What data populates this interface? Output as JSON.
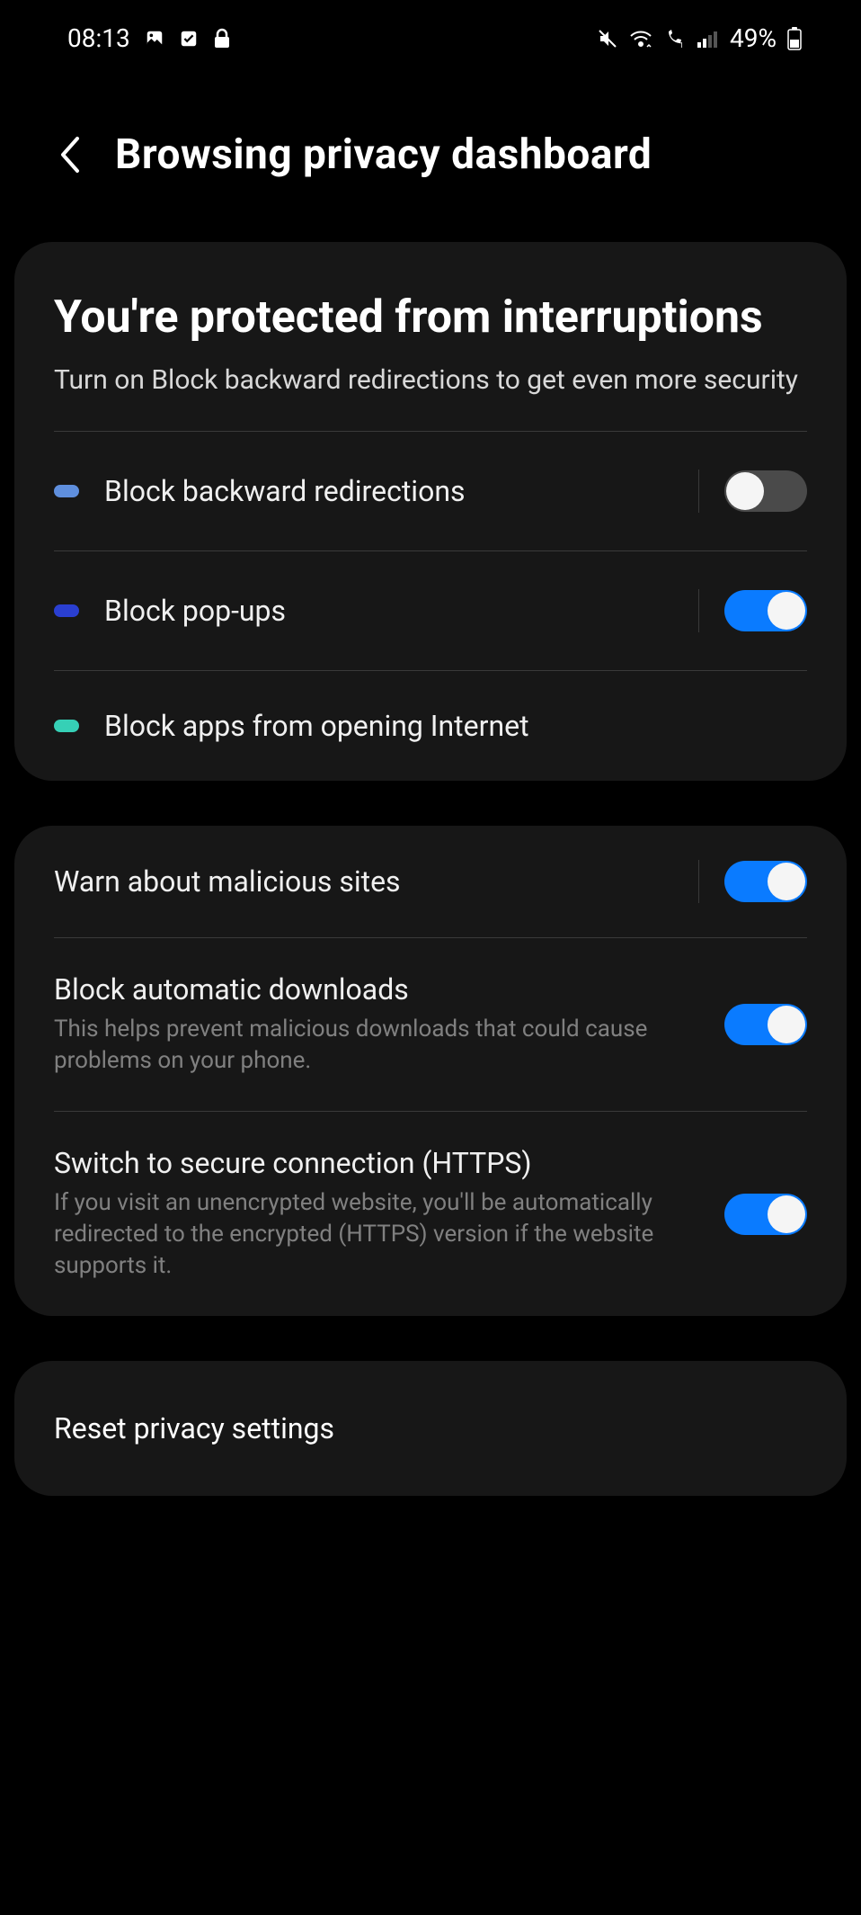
{
  "status": {
    "time": "08:13",
    "battery_pct": "49%"
  },
  "header": {
    "title": "Browsing privacy dashboard"
  },
  "hero": {
    "title": "You're protected from interruptions",
    "subtitle": "Turn on Block backward redirections to get even more security"
  },
  "section1": {
    "backward": {
      "label": "Block backward redirections",
      "on": false
    },
    "popups": {
      "label": "Block pop-ups",
      "on": true
    },
    "apps": {
      "label": "Block apps from opening Internet"
    }
  },
  "section2": {
    "warn": {
      "title": "Warn about malicious sites",
      "on": true
    },
    "auto_dl": {
      "title": "Block automatic downloads",
      "sub": "This helps prevent malicious downloads that could cause problems on your phone.",
      "on": true
    },
    "https": {
      "title": "Switch to secure connection (HTTPS)",
      "sub": "If you visit an unencrypted website, you'll be automatically redirected to the encrypted (HTTPS) version if the website supports it.",
      "on": true
    }
  },
  "reset": {
    "label": "Reset privacy settings"
  }
}
